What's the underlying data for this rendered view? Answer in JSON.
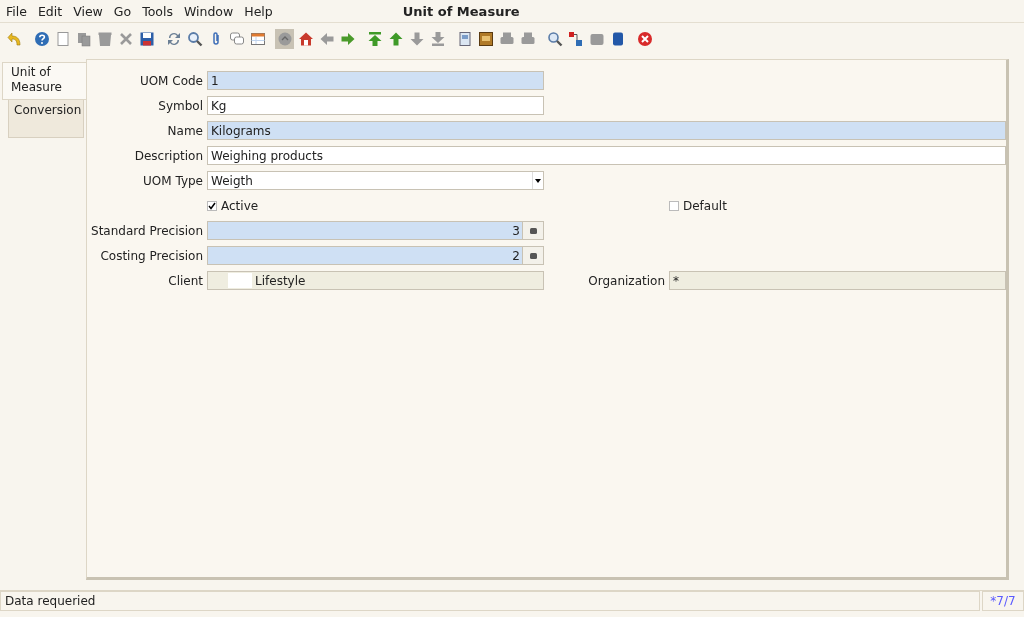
{
  "menu": [
    {
      "label": "File"
    },
    {
      "label": "Edit"
    },
    {
      "label": "View"
    },
    {
      "label": "Go"
    },
    {
      "label": "Tools"
    },
    {
      "label": "Window"
    },
    {
      "label": "Help"
    }
  ],
  "window": {
    "title": "Unit of Measure"
  },
  "toolbar": [
    {
      "buttons": [
        {
          "kind": "undo",
          "disabled": false
        }
      ]
    },
    {
      "buttons": [
        {
          "kind": "help",
          "disabled": false
        },
        {
          "kind": "new",
          "disabled": false
        },
        {
          "kind": "copy",
          "disabled": true
        },
        {
          "kind": "delete",
          "disabled": true
        },
        {
          "kind": "delete-selection",
          "disabled": true
        },
        {
          "kind": "save",
          "disabled": false
        }
      ]
    },
    {
      "buttons": [
        {
          "kind": "refresh",
          "disabled": false
        },
        {
          "kind": "find",
          "disabled": false
        },
        {
          "kind": "attach",
          "disabled": false
        },
        {
          "kind": "chat",
          "disabled": false
        },
        {
          "kind": "grid",
          "disabled": false
        }
      ]
    },
    {
      "buttons": [
        {
          "kind": "history",
          "disabled": true,
          "selected": true
        },
        {
          "kind": "home",
          "disabled": false
        },
        {
          "kind": "back",
          "disabled": true
        },
        {
          "kind": "forward",
          "disabled": false
        }
      ]
    },
    {
      "buttons": [
        {
          "kind": "first",
          "disabled": false
        },
        {
          "kind": "previous",
          "disabled": false
        },
        {
          "kind": "next",
          "disabled": true
        },
        {
          "kind": "last",
          "disabled": true
        }
      ]
    },
    {
      "buttons": [
        {
          "kind": "report",
          "disabled": false
        },
        {
          "kind": "archive",
          "disabled": false
        },
        {
          "kind": "preview",
          "disabled": true
        },
        {
          "kind": "print",
          "disabled": true
        }
      ]
    },
    {
      "buttons": [
        {
          "kind": "zoom",
          "disabled": false
        },
        {
          "kind": "workflow",
          "disabled": false
        },
        {
          "kind": "info",
          "disabled": true
        },
        {
          "kind": "end",
          "disabled": false
        }
      ]
    },
    {
      "buttons": [
        {
          "kind": "exit",
          "disabled": false
        }
      ]
    }
  ],
  "tabs": [
    {
      "label": "Unit of Measure",
      "selected": true
    },
    {
      "label": "Conversion",
      "selected": false
    }
  ],
  "form": [
    {
      "left": {
        "kind": "text",
        "label": "UOM Code",
        "value": "1",
        "mandatory": true,
        "disabled": false
      }
    },
    {
      "left": {
        "kind": "text",
        "label": "Symbol",
        "value": "Kg",
        "mandatory": false,
        "disabled": false
      }
    },
    {
      "left": {
        "kind": "text",
        "label": "Name",
        "value": "Kilograms",
        "mandatory": true,
        "disabled": false
      }
    },
    {
      "left": {
        "kind": "text",
        "label": "Description",
        "value": "Weighing products",
        "mandatory": false,
        "disabled": false
      }
    },
    {
      "left": {
        "kind": "select",
        "label": "UOM Type",
        "value": "Weigth",
        "mandatory": false,
        "disabled": false
      }
    },
    {
      "left": {
        "kind": "checkbox",
        "label": "Active",
        "checked": true
      },
      "right": {
        "kind": "checkbox",
        "label": "Default",
        "checked": false
      }
    },
    {
      "left": {
        "kind": "number",
        "label": "Standard Precision",
        "value": "3",
        "mandatory": true,
        "disabled": false
      }
    },
    {
      "left": {
        "kind": "number",
        "label": "Costing Precision",
        "value": "2",
        "mandatory": true,
        "disabled": false
      }
    },
    {
      "left": {
        "kind": "text",
        "label": "Client",
        "value": "Lifestyle",
        "disabled": true,
        "redacted": true
      },
      "right": {
        "kind": "text",
        "label": "Organization",
        "value": "*",
        "disabled": true
      }
    }
  ],
  "status_bar": {
    "message": "Data requeried",
    "record": "*7/7"
  }
}
